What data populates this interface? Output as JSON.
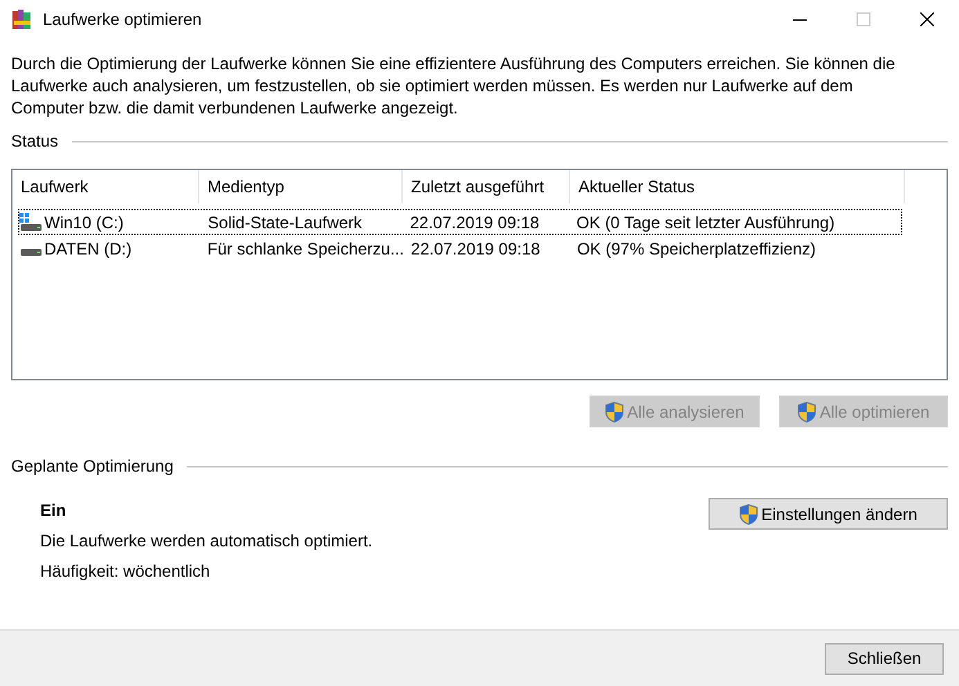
{
  "window": {
    "title": "Laufwerke optimieren"
  },
  "description": "Durch die Optimierung der Laufwerke können Sie eine effizientere Ausführung des Computers erreichen. Sie können die Laufwerke auch analysieren, um festzustellen, ob sie optimiert werden müssen. Es werden nur Laufwerke auf dem Computer bzw. die damit verbundenen Laufwerke angezeigt.",
  "status": {
    "heading": "Status",
    "table": {
      "columns": [
        "Laufwerk",
        "Medientyp",
        "Zuletzt ausgeführt",
        "Aktueller Status"
      ],
      "rows": [
        {
          "kind": "system",
          "focused": true,
          "cells": [
            "Win10 (C:)",
            "Solid-State-Laufwerk",
            "22.07.2019 09:18",
            "OK (0 Tage seit letzter Ausführung)"
          ]
        },
        {
          "kind": "data",
          "focused": false,
          "cells": [
            "DATEN (D:)",
            "Für schlanke Speicherzu...",
            "22.07.2019 09:18",
            "OK (97% Speicherplatzeffizienz)"
          ]
        }
      ]
    },
    "buttons": [
      {
        "label": "Alle analysieren",
        "disabled": true
      },
      {
        "label": "Alle optimieren",
        "disabled": true
      }
    ]
  },
  "schedule": {
    "heading": "Geplante Optimierung",
    "state": "Ein",
    "info": "Die Laufwerke werden automatisch optimiert.",
    "frequency": "Häufigkeit: wöchentlich",
    "button": {
      "label": "Einstellungen ändern",
      "disabled": false
    }
  },
  "footer": {
    "button": "Schließen"
  }
}
